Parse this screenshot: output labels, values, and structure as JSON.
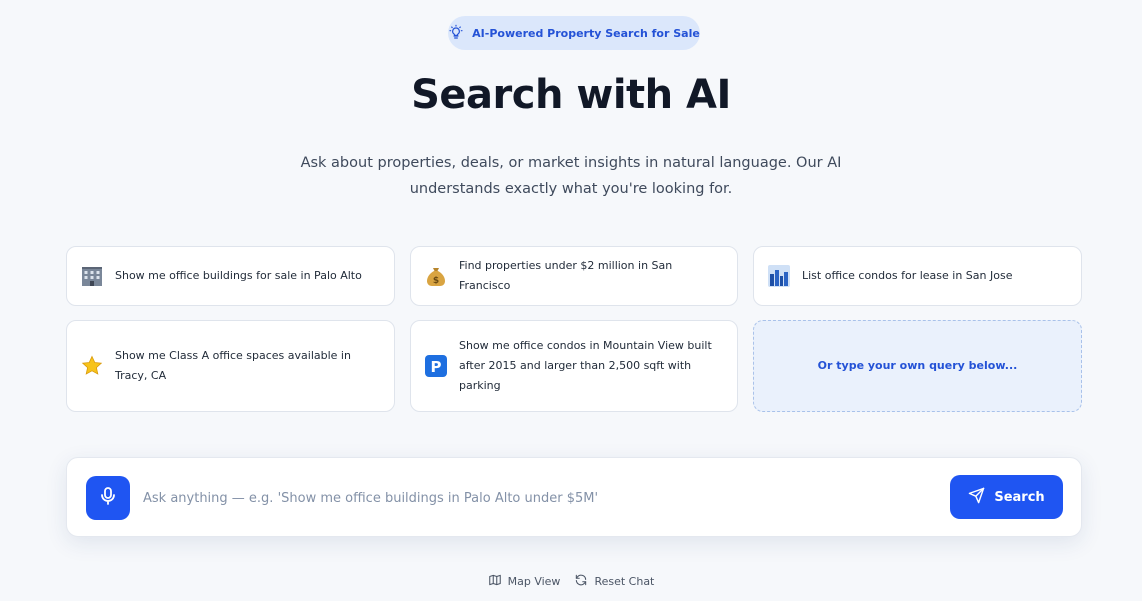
{
  "badge": {
    "label": "AI-Powered Property Search for Sale",
    "icon": "lightbulb-icon"
  },
  "hero": {
    "title": "Search with AI",
    "subtitle": "Ask about properties, deals, or market insights in natural language. Our AI understands exactly what you're looking for."
  },
  "suggestions": [
    {
      "icon": "office-building-icon",
      "text": "Show me office buildings for sale in Palo Alto"
    },
    {
      "icon": "money-bag-icon",
      "text": "Find properties under $2 million in San Francisco"
    },
    {
      "icon": "cityscape-icon",
      "text": "List office condos for lease in San Jose"
    },
    {
      "icon": "star-icon",
      "text": "Show me Class A office spaces available in Tracy, CA"
    },
    {
      "icon": "parking-icon",
      "text": "Show me office condos in Mountain View built after 2015 and larger than 2,500 sqft with parking"
    },
    {
      "icon": "",
      "text": "Or type your own query below..."
    }
  ],
  "search": {
    "placeholder": "Ask anything — e.g. 'Show me office buildings in Palo Alto under $5M'",
    "value": "",
    "button_label": "Search"
  },
  "footer": {
    "map_view": "Map View",
    "reset_chat": "Reset Chat"
  },
  "colors": {
    "accent": "#1f55f2",
    "badge_bg": "#dbe7fb",
    "page_bg": "#f6f8fb"
  }
}
